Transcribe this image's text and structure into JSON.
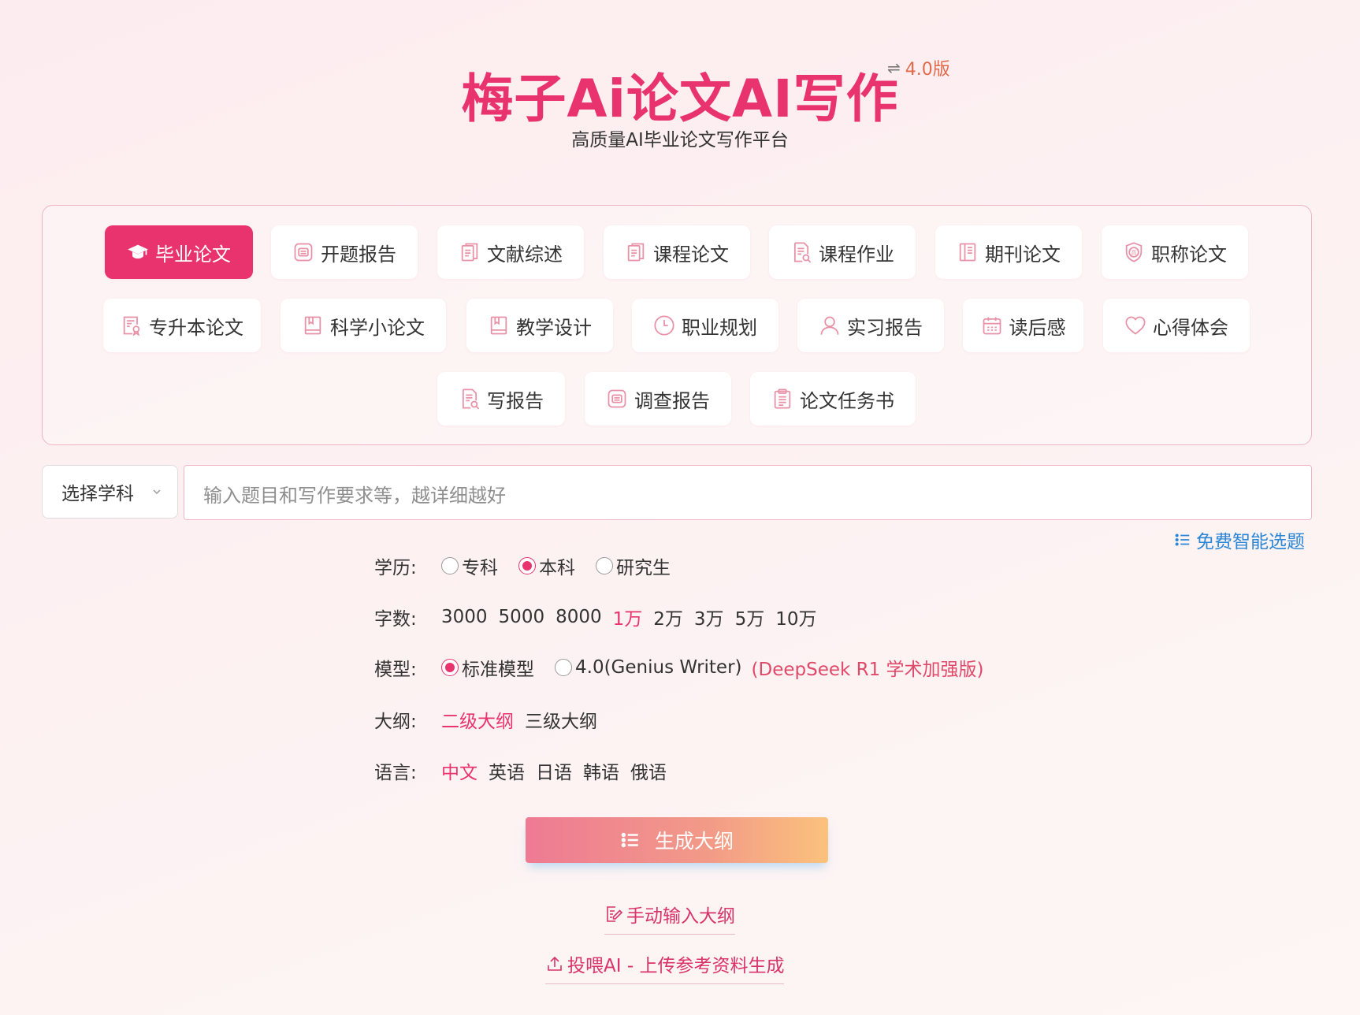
{
  "header": {
    "brand": "梅子Ai论文AI写作",
    "version": "4.0版",
    "subtitle": "高质量AI毕业论文写作平台"
  },
  "categories": [
    {
      "label": "毕业论文",
      "icon": "graduation-cap-icon",
      "active": true
    },
    {
      "label": "开题报告",
      "icon": "report-icon"
    },
    {
      "label": "文献综述",
      "icon": "documents-icon"
    },
    {
      "label": "课程论文",
      "icon": "documents-icon"
    },
    {
      "label": "课程作业",
      "icon": "document-search-icon"
    },
    {
      "label": "期刊论文",
      "icon": "journal-icon"
    },
    {
      "label": "职称论文",
      "icon": "shield-badge-icon"
    },
    {
      "label": "专升本论文",
      "icon": "certificate-icon"
    },
    {
      "label": "科学小论文",
      "icon": "bookmark-book-icon"
    },
    {
      "label": "教学设计",
      "icon": "bookmark-book-icon"
    },
    {
      "label": "职业规划",
      "icon": "clock-icon"
    },
    {
      "label": "实习报告",
      "icon": "user-icon"
    },
    {
      "label": "读后感",
      "icon": "calendar-icon"
    },
    {
      "label": "心得体会",
      "icon": "heart-icon"
    },
    {
      "label": "写报告",
      "icon": "document-search-icon"
    },
    {
      "label": "调查报告",
      "icon": "report-icon"
    },
    {
      "label": "论文任务书",
      "icon": "clipboard-icon"
    }
  ],
  "input": {
    "subject_placeholder": "选择学科",
    "topic_placeholder": "输入题目和写作要求等，越详细越好",
    "free_topic": "免费智能选题"
  },
  "options": {
    "education": {
      "label": "学历:",
      "items": [
        "专科",
        "本科",
        "研究生"
      ],
      "selected": "本科"
    },
    "word_count": {
      "label": "字数:",
      "items": [
        "3000",
        "5000",
        "8000",
        "1万",
        "2万",
        "3万",
        "5万",
        "10万"
      ],
      "selected": "1万"
    },
    "model": {
      "label": "模型:",
      "items": [
        "标准模型",
        "4.0(Genius Writer)"
      ],
      "selected": "标准模型",
      "note": "(DeepSeek R1 学术加强版)"
    },
    "outline": {
      "label": "大纲:",
      "items": [
        "二级大纲",
        "三级大纲"
      ],
      "selected": "二级大纲"
    },
    "language": {
      "label": "语言:",
      "items": [
        "中文",
        "英语",
        "日语",
        "韩语",
        "俄语"
      ],
      "selected": "中文"
    }
  },
  "actions": {
    "generate": "生成大纲",
    "manual_outline": "手动输入大纲",
    "upload": "投喂AI - 上传参考资料生成"
  },
  "colors": {
    "accent": "#e8336f",
    "link_blue": "#2a86d6",
    "note_red": "#e04a6a"
  }
}
